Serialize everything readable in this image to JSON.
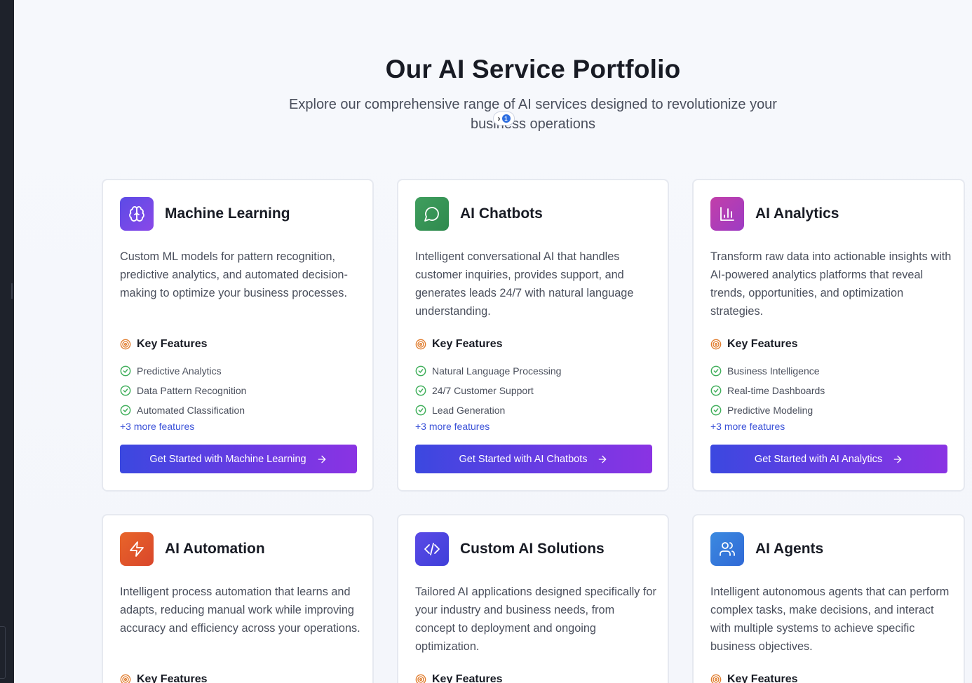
{
  "header": {
    "title": "Our AI Service Portfolio",
    "subtitle": "Explore our comprehensive range of AI services designed to revolutionize your business operations"
  },
  "colors": {
    "accent": "#3b52d8",
    "cta_gradient_start": "#3b48e0",
    "cta_gradient_end": "#8a33e3",
    "check": "#3fae5a",
    "target": "#e07a2a"
  },
  "key_features_label": "Key Features",
  "cards": [
    {
      "title": "Machine Learning",
      "icon": "brain-icon",
      "icon_gradient": [
        "#5b4be6",
        "#8a48e8"
      ],
      "description": "Custom ML models for pattern recognition, predictive analytics, and automated decision-making to optimize your business processes.",
      "features": [
        "Predictive Analytics",
        "Data Pattern Recognition",
        "Automated Classification"
      ],
      "more": "+3 more features",
      "cta": "Get Started with Machine Learning"
    },
    {
      "title": "AI Chatbots",
      "icon": "chat-bubble-icon",
      "icon_gradient": [
        "#3f9e5e",
        "#2f8a4e"
      ],
      "description": "Intelligent conversational AI that handles customer inquiries, provides support, and generates leads 24/7 with natural language understanding.",
      "features": [
        "Natural Language Processing",
        "24/7 Customer Support",
        "Lead Generation"
      ],
      "more": "+3 more features",
      "cta": "Get Started with AI Chatbots"
    },
    {
      "title": "AI Analytics",
      "icon": "bar-chart-icon",
      "icon_gradient": [
        "#c23fa9",
        "#9d3bc4"
      ],
      "description": "Transform raw data into actionable insights with AI-powered analytics platforms that reveal trends, opportunities, and optimization strategies.",
      "features": [
        "Business Intelligence",
        "Real-time Dashboards",
        "Predictive Modeling"
      ],
      "more": "+3 more features",
      "cta": "Get Started with AI Analytics"
    },
    {
      "title": "AI Automation",
      "icon": "lightning-icon",
      "icon_gradient": [
        "#e8652a",
        "#d9462b"
      ],
      "description": "Intelligent process automation that learns and adapts, reducing manual work while improving accuracy and efficiency across your operations.",
      "key_features": "Key Features"
    },
    {
      "title": "Custom AI Solutions",
      "icon": "code-icon",
      "icon_gradient": [
        "#5a4ae6",
        "#3f3fd9"
      ],
      "description": "Tailored AI applications designed specifically for your industry and business needs, from concept to deployment and ongoing optimization.",
      "key_features": "Key Features"
    },
    {
      "title": "AI Agents",
      "icon": "users-icon",
      "icon_gradient": [
        "#3b8ae0",
        "#3069d6"
      ],
      "description": "Intelligent autonomous agents that can perform complex tasks, make decisions, and interact with multiple systems to achieve specific business objectives.",
      "key_features": "Key Features"
    }
  ]
}
